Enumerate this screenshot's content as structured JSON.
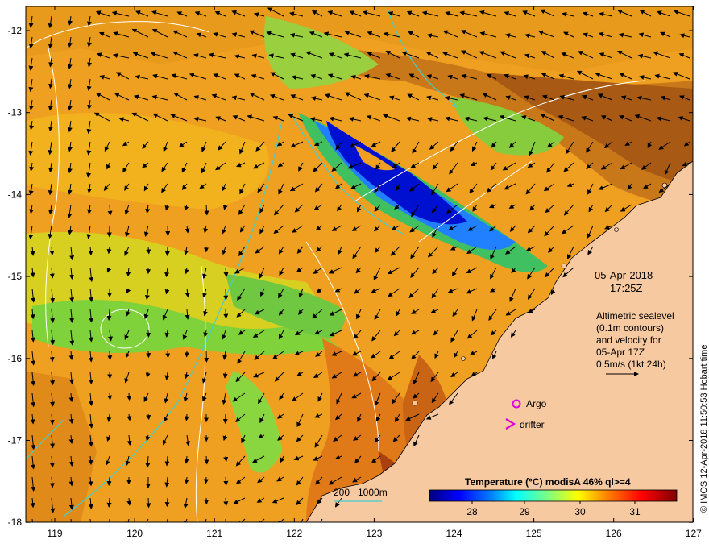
{
  "map": {
    "lon_ticks": [
      "119",
      "120",
      "121",
      "122",
      "123",
      "124",
      "125",
      "126",
      "127"
    ],
    "lat_ticks": [
      "-12",
      "-13",
      "-14",
      "-15",
      "-16",
      "-17",
      "-18"
    ]
  },
  "info": {
    "date": "05-Apr-2018",
    "time": "17:25Z",
    "alt_line1": "Altimetric sealevel",
    "alt_line2": "(0.1m contours)",
    "alt_line3": "and velocity for",
    "alt_line4": "05-Apr 17Z",
    "alt_line5": "0.5m/s (1kt 24h)"
  },
  "legend": {
    "argo": "Argo",
    "drifter": "drifter",
    "depth_200": "200",
    "depth_1000": "1000m"
  },
  "colorbar": {
    "title": "Temperature  (°C) modisA 46% ql>=4",
    "ticks": [
      "28",
      "29",
      "30",
      "31"
    ],
    "colors": [
      "#00007f",
      "#0000ff",
      "#0080ff",
      "#00ffff",
      "#80ff80",
      "#ffff00",
      "#ff8000",
      "#ff0000",
      "#7f0000"
    ]
  },
  "credit": "© IMOS 12-Apr-2018 11:50:53 Hobart time",
  "colors": {
    "land": "#f7c9a0",
    "coast": "#000000",
    "isobath": "#40d0d0",
    "contour": "#ffffff",
    "argo": "#e000e0"
  }
}
